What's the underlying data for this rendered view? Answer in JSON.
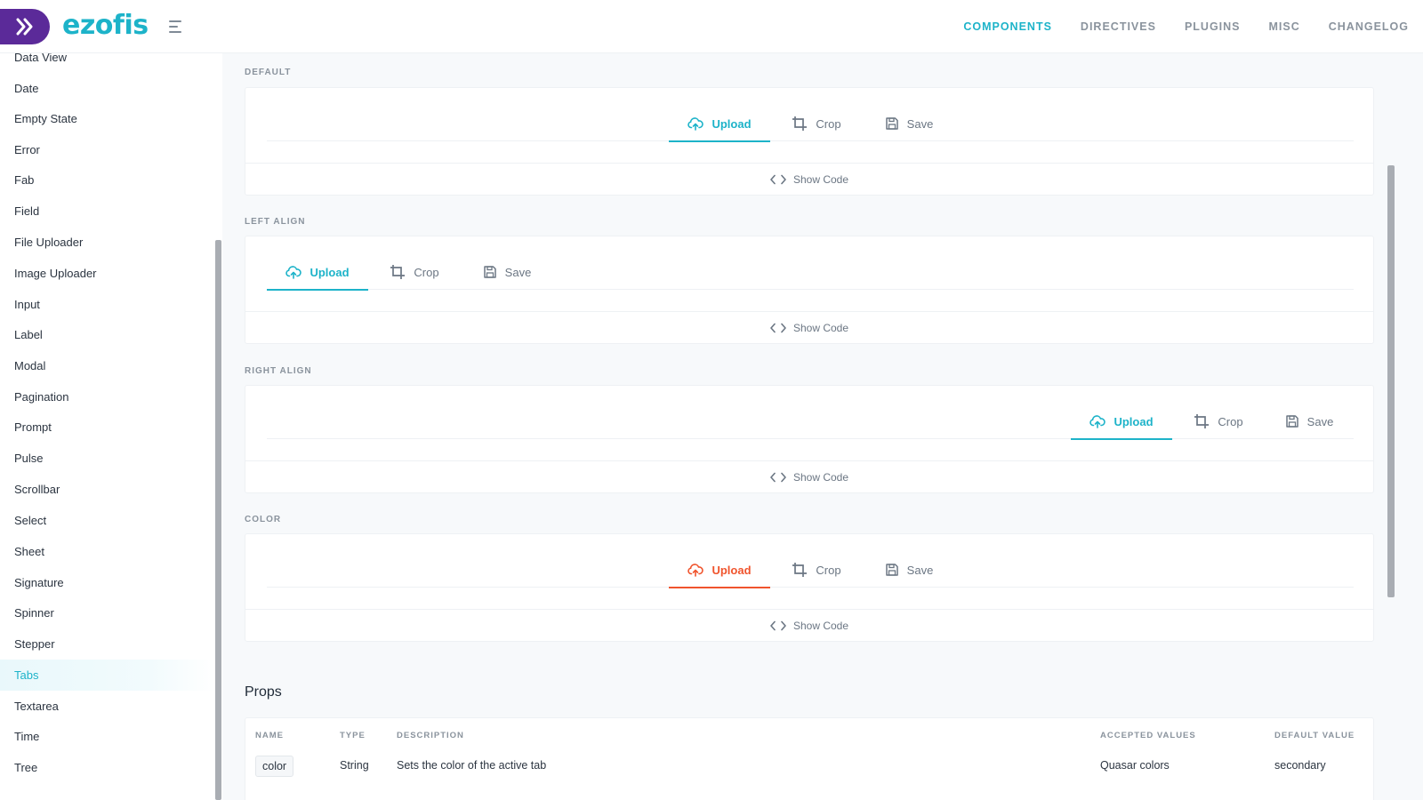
{
  "header": {
    "logo_text": "ezofis",
    "nav": [
      "COMPONENTS",
      "DIRECTIVES",
      "PLUGINS",
      "MISC",
      "CHANGELOG"
    ],
    "active_nav": "COMPONENTS"
  },
  "sidebar": {
    "items": [
      "Data View",
      "Date",
      "Empty State",
      "Error",
      "Fab",
      "Field",
      "File Uploader",
      "Image Uploader",
      "Input",
      "Label",
      "Modal",
      "Pagination",
      "Prompt",
      "Pulse",
      "Scrollbar",
      "Select",
      "Sheet",
      "Signature",
      "Spinner",
      "Stepper",
      "Tabs",
      "Textarea",
      "Time",
      "Tree"
    ],
    "active": "Tabs"
  },
  "sections": [
    {
      "label": "DEFAULT",
      "tabs": [
        "Upload",
        "Crop",
        "Save"
      ],
      "show_code": "Show Code"
    },
    {
      "label": "LEFT ALIGN",
      "tabs": [
        "Upload",
        "Crop",
        "Save"
      ],
      "show_code": "Show Code"
    },
    {
      "label": "RIGHT ALIGN",
      "tabs": [
        "Upload",
        "Crop",
        "Save"
      ],
      "show_code": "Show Code"
    },
    {
      "label": "COLOR",
      "tabs": [
        "Upload",
        "Crop",
        "Save"
      ],
      "show_code": "Show Code"
    }
  ],
  "icons": {
    "upload": "cloud-upload-icon",
    "crop": "crop-icon",
    "save": "save-icon",
    "code": "code-icon",
    "logo": "double-chevron-icon",
    "menu": "menu-icon"
  },
  "colors": {
    "accent": "#1db3c9",
    "color_tab": "#f0542d",
    "logo_badge": "#5b2a99"
  },
  "props": {
    "title": "Props",
    "columns": [
      "NAME",
      "TYPE",
      "DESCRIPTION",
      "ACCEPTED VALUES",
      "DEFAULT VALUE"
    ],
    "rows": [
      {
        "name": "color",
        "type": "String",
        "description": "Sets the color of the active tab",
        "accepted": "Quasar colors",
        "default": "secondary"
      }
    ]
  }
}
